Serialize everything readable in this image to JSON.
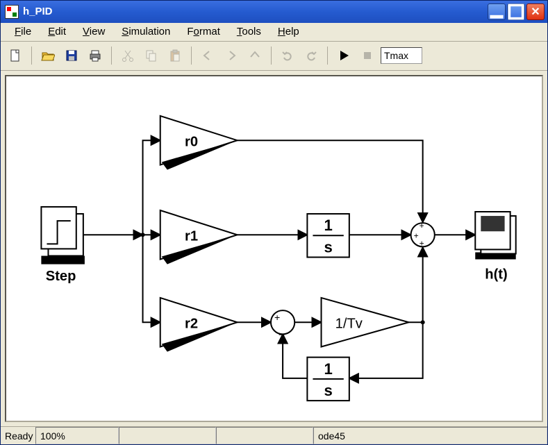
{
  "window": {
    "title": "h_PID"
  },
  "menu": {
    "file": "File",
    "edit": "Edit",
    "view": "View",
    "simulation": "Simulation",
    "format": "Format",
    "tools": "Tools",
    "help": "Help"
  },
  "toolbar": {
    "tmax_field": "Tmax"
  },
  "status": {
    "ready_label": "Ready",
    "progress": "100%",
    "solver": "ode45"
  },
  "diagram": {
    "step_label": "Step",
    "scope_label": "h(t)",
    "gain0": "r0",
    "gain1": "r1",
    "gain2": "r2",
    "gain3": "1/Tv",
    "integrator1_num": "1",
    "integrator1_den": "s",
    "integrator2_num": "1",
    "integrator2_den": "s"
  }
}
